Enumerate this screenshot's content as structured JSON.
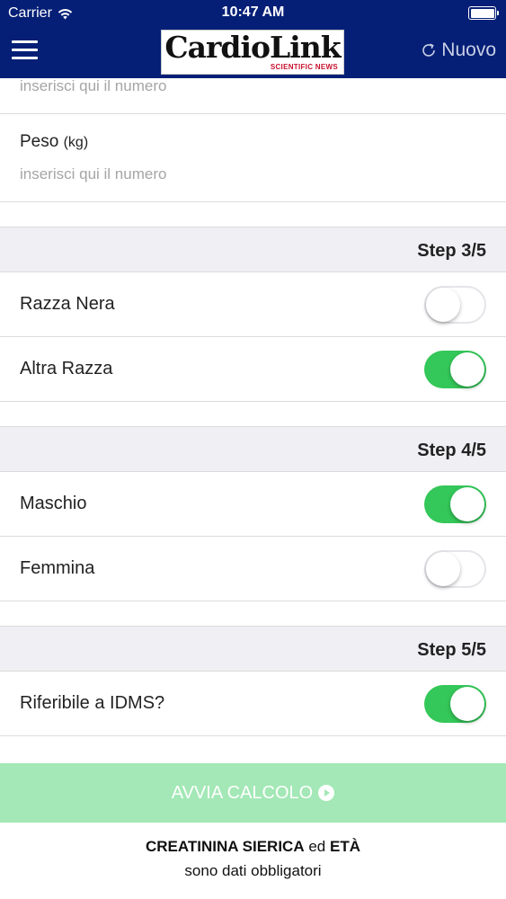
{
  "status_bar": {
    "carrier": "Carrier",
    "time": "10:47 AM",
    "icons": [
      "wifi-icon",
      "battery-icon"
    ]
  },
  "header": {
    "logo_text": "CardioLink",
    "logo_subtext": "SCIENTIFIC NEWS",
    "menu_icon": "hamburger-icon",
    "new_button_label": "Nuovo",
    "new_button_icon": "refresh-icon",
    "background_color": "#051f76"
  },
  "form": {
    "partial_field_placeholder": "inserisci qui il numero",
    "weight_field": {
      "label": "Peso",
      "unit": "(kg)",
      "placeholder": "inserisci qui il numero"
    },
    "steps": [
      {
        "header": "Step 3/5",
        "toggles": [
          {
            "label": "Razza Nera",
            "on": false
          },
          {
            "label": "Altra Razza",
            "on": true
          }
        ]
      },
      {
        "header": "Step 4/5",
        "toggles": [
          {
            "label": "Maschio",
            "on": true
          },
          {
            "label": "Femmina",
            "on": false
          }
        ]
      },
      {
        "header": "Step 5/5",
        "toggles": [
          {
            "label": "Riferibile a IDMS?",
            "on": true
          }
        ]
      }
    ]
  },
  "action": {
    "label": "AVVIA CALCOLO",
    "icon": "play-circle-icon",
    "color": "#a3e8b6"
  },
  "footer": {
    "required_1": "CREATININA SIERICA",
    "connector": "ed",
    "required_2": "ETÀ",
    "line2": "sono dati obbligatori"
  },
  "colors": {
    "toggle_on": "#34c759",
    "section_header_bg": "#efeff4"
  }
}
